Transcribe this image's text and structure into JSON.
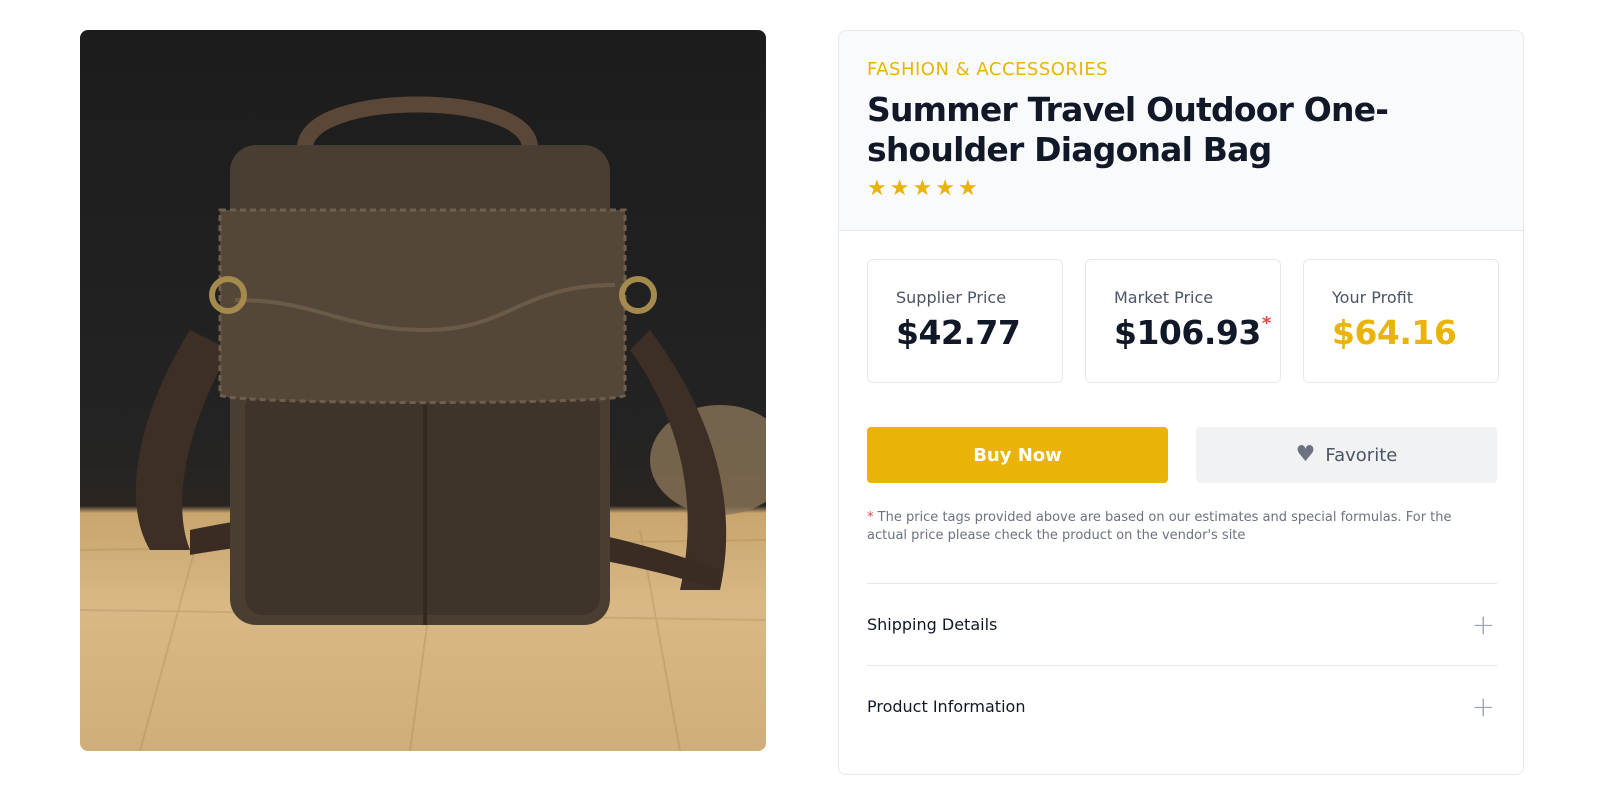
{
  "product": {
    "image_alt": "Brown leather crossbody bag",
    "category": "FASHION & ACCESSORIES",
    "title": "Summer Travel Outdoor One-shoulder Diagonal Bag",
    "rating_stars": 5
  },
  "prices": {
    "supplier": {
      "label": "Supplier Price",
      "value": "$42.77"
    },
    "market": {
      "label": "Market Price",
      "value": "$106.93",
      "asterisk": "*"
    },
    "profit": {
      "label": "Your Profit",
      "value": "$64.16"
    }
  },
  "actions": {
    "buy_label": "Buy Now",
    "favorite_label": "Favorite"
  },
  "disclaimer": {
    "asterisk": "*",
    "text": "The price tags provided above are based on our estimates and special formulas. For the actual price please check the product on the vendor's site"
  },
  "accordion": [
    {
      "label": "Shipping Details",
      "toggle": "+"
    },
    {
      "label": "Product Information",
      "toggle": "+"
    }
  ],
  "colors": {
    "accent": "#eab308",
    "text": "#111827",
    "muted": "#6b7280",
    "danger": "#ef4444"
  },
  "icons": {
    "star": "star-icon",
    "heart": "heart-icon",
    "plus": "plus-icon"
  }
}
